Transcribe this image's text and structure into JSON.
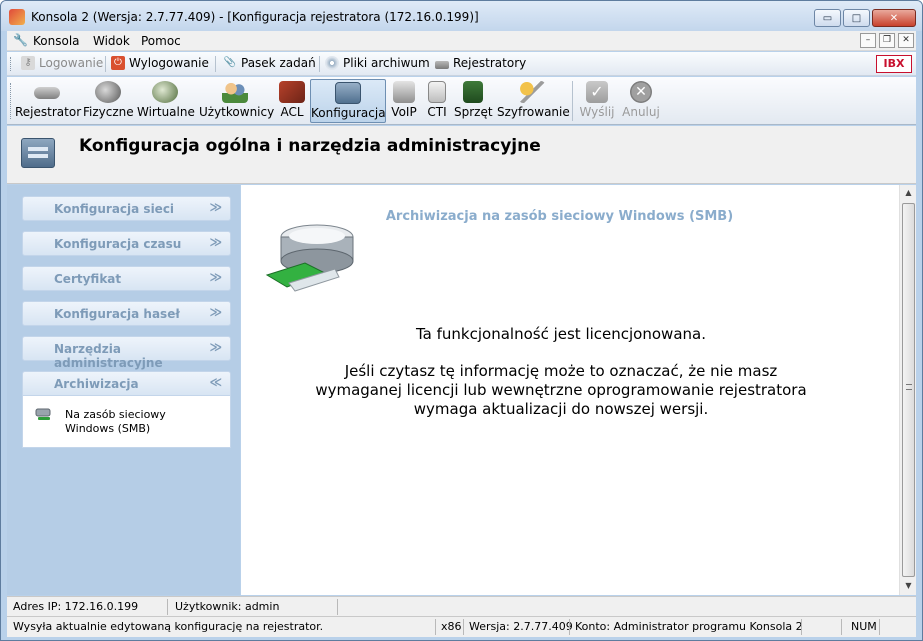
{
  "window": {
    "title": "Konsola 2 (Wersja:  2.7.77.409) - [Konfiguracja rejestratora (172.16.0.199)]",
    "caption_buttons": {
      "minimize": "▭",
      "maximize": "□",
      "close": "✕"
    }
  },
  "menu": {
    "items": [
      "Konsola",
      "Widok",
      "Pomoc"
    ],
    "mdi_buttons": {
      "minimize": "–",
      "restore": "❐",
      "close": "✕"
    }
  },
  "quick_toolbar": {
    "items": [
      {
        "label": "Logowanie",
        "icon": "key-icon",
        "enabled": false
      },
      {
        "label": "Wylogowanie",
        "icon": "power-icon",
        "enabled": true
      },
      {
        "label": "Pasek zadań",
        "icon": "paperclip-icon",
        "enabled": true
      },
      {
        "label": "Pliki archiwum",
        "icon": "disc-icon",
        "enabled": true
      },
      {
        "label": "Rejestratory",
        "icon": "recorder-icon",
        "enabled": true
      }
    ],
    "logo": "IBX"
  },
  "main_toolbar": {
    "buttons": [
      {
        "label": "Rejestrator",
        "icon": "recorder-icon",
        "active": false,
        "enabled": true
      },
      {
        "label": "Fizyczne",
        "icon": "physical-channel-icon",
        "active": false,
        "enabled": true
      },
      {
        "label": "Wirtualne",
        "icon": "virtual-channel-icon",
        "active": false,
        "enabled": true
      },
      {
        "label": "Użytkownicy",
        "icon": "users-icon",
        "active": false,
        "enabled": true
      },
      {
        "label": "ACL",
        "icon": "acl-icon",
        "active": false,
        "enabled": true
      },
      {
        "label": "Konfiguracja",
        "icon": "configuration-icon",
        "active": true,
        "enabled": true
      },
      {
        "label": "VoIP",
        "icon": "voip-icon",
        "active": false,
        "enabled": true
      },
      {
        "label": "CTI",
        "icon": "cti-icon",
        "active": false,
        "enabled": true
      },
      {
        "label": "Sprzęt",
        "icon": "hardware-icon",
        "active": false,
        "enabled": true
      },
      {
        "label": "Szyfrowanie",
        "icon": "encryption-icon",
        "active": false,
        "enabled": true
      },
      {
        "label": "Wyślij",
        "icon": "checkmark-icon",
        "active": false,
        "enabled": false
      },
      {
        "label": "Anuluj",
        "icon": "cancel-icon",
        "active": false,
        "enabled": false
      }
    ]
  },
  "header": {
    "title": "Konfiguracja ogólna i narzędzia administracyjne"
  },
  "sidebar": {
    "sections": [
      {
        "label": "Konfiguracja sieci",
        "expanded": false
      },
      {
        "label": "Konfiguracja czasu",
        "expanded": false
      },
      {
        "label": "Certyfikat",
        "expanded": false
      },
      {
        "label": "Konfiguracja haseł",
        "expanded": false
      },
      {
        "label": "Narzędzia administracyjne",
        "expanded": false
      },
      {
        "label": "Archiwizacja",
        "expanded": true
      }
    ],
    "archive_link": "Na zasób sieciowy Windows (SMB)",
    "chevron_collapsed": "≫",
    "chevron_expanded": "≪"
  },
  "content": {
    "section_title": "Archiwizacja na zasób sieciowy Windows (SMB)",
    "message_main": "Ta funkcjonalność jest licencjonowana.",
    "message_detail": "Jeśli czytasz tę informację może to oznaczać, że nie masz wymaganej licencji lub wewnętrzne oprogramowanie rejestratora wymaga aktualizacji do nowszej wersji."
  },
  "status": {
    "ip": "Adres IP: 172.16.0.199",
    "user": "Użytkownik: admin",
    "hint": "Wysyła aktualnie edytowaną konfigurację na rejestrator.",
    "arch": "x86",
    "version": "Wersja: 2.7.77.409",
    "account": "Konto: Administrator programu Konsola 2",
    "num": "NUM"
  },
  "colors": {
    "accent": "#b5cde6",
    "sidebar_label": "#7e9bb8",
    "section_title": "#8aaccc"
  }
}
